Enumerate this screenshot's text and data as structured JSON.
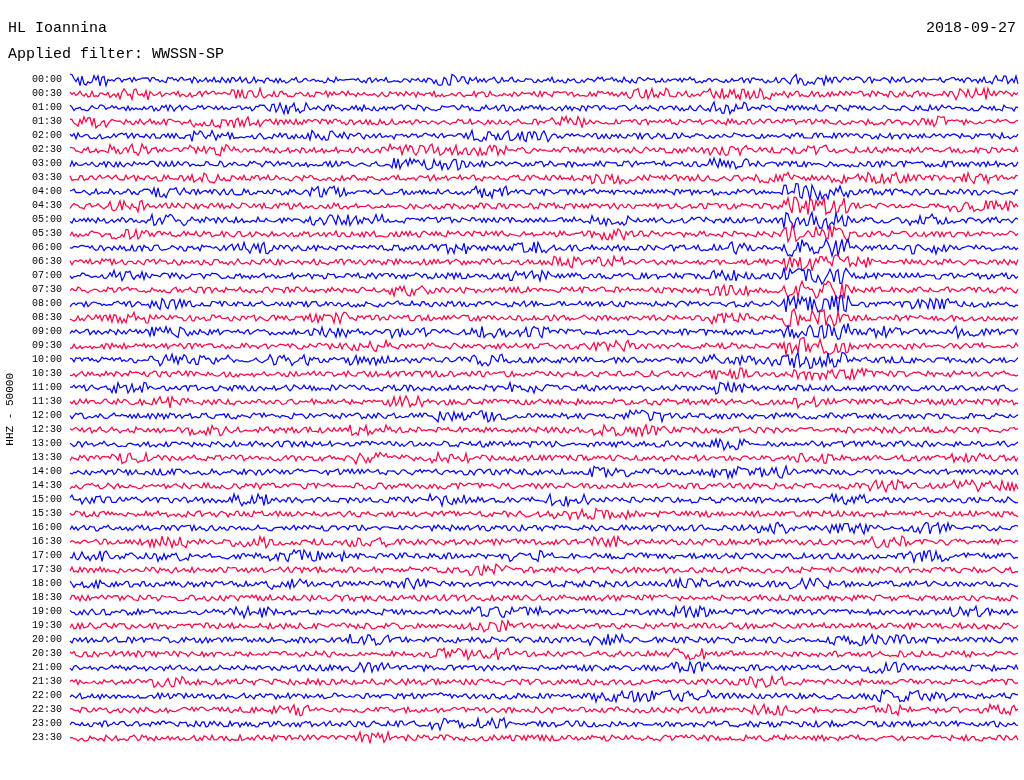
{
  "header": {
    "station": "HL Ioannina",
    "date": "2018-09-27",
    "filter": "Applied filter: WWSSN-SP"
  },
  "channel_label": "HHZ - 50000",
  "traces": [
    {
      "time": "00:00",
      "color": "#0000ff"
    },
    {
      "time": "00:30",
      "color": "#ff0040"
    },
    {
      "time": "01:00",
      "color": "#0000ff"
    },
    {
      "time": "01:30",
      "color": "#ff0040"
    },
    {
      "time": "02:00",
      "color": "#0000ff"
    },
    {
      "time": "02:30",
      "color": "#ff0040"
    },
    {
      "time": "03:00",
      "color": "#0000ff"
    },
    {
      "time": "03:30",
      "color": "#ff0040"
    },
    {
      "time": "04:00",
      "color": "#0000ff"
    },
    {
      "time": "04:30",
      "color": "#ff0040"
    },
    {
      "time": "05:00",
      "color": "#0000ff"
    },
    {
      "time": "05:30",
      "color": "#ff0040"
    },
    {
      "time": "06:00",
      "color": "#0000ff"
    },
    {
      "time": "06:30",
      "color": "#ff0040"
    },
    {
      "time": "07:00",
      "color": "#0000ff"
    },
    {
      "time": "07:30",
      "color": "#ff0040"
    },
    {
      "time": "08:00",
      "color": "#0000ff"
    },
    {
      "time": "08:30",
      "color": "#ff0040"
    },
    {
      "time": "09:00",
      "color": "#0000ff"
    },
    {
      "time": "09:30",
      "color": "#ff0040"
    },
    {
      "time": "10:00",
      "color": "#0000ff"
    },
    {
      "time": "10:30",
      "color": "#ff0040"
    },
    {
      "time": "11:00",
      "color": "#0000ff"
    },
    {
      "time": "11:30",
      "color": "#ff0040"
    },
    {
      "time": "12:00",
      "color": "#0000ff"
    },
    {
      "time": "12:30",
      "color": "#ff0040"
    },
    {
      "time": "13:00",
      "color": "#0000ff"
    },
    {
      "time": "13:30",
      "color": "#ff0040"
    },
    {
      "time": "14:00",
      "color": "#0000ff"
    },
    {
      "time": "14:30",
      "color": "#ff0040"
    },
    {
      "time": "15:00",
      "color": "#0000ff"
    },
    {
      "time": "15:30",
      "color": "#ff0040"
    },
    {
      "time": "16:00",
      "color": "#0000ff"
    },
    {
      "time": "16:30",
      "color": "#ff0040"
    },
    {
      "time": "17:00",
      "color": "#0000ff"
    },
    {
      "time": "17:30",
      "color": "#ff0040"
    },
    {
      "time": "18:00",
      "color": "#0000ff"
    },
    {
      "time": "18:30",
      "color": "#ff0040"
    },
    {
      "time": "19:00",
      "color": "#0000ff"
    },
    {
      "time": "19:30",
      "color": "#ff0040"
    },
    {
      "time": "20:00",
      "color": "#0000ff"
    },
    {
      "time": "20:30",
      "color": "#ff0040"
    },
    {
      "time": "21:00",
      "color": "#0000ff"
    },
    {
      "time": "21:30",
      "color": "#ff0040"
    },
    {
      "time": "22:00",
      "color": "#0000ff"
    },
    {
      "time": "22:30",
      "color": "#ff0040"
    },
    {
      "time": "23:00",
      "color": "#0000ff"
    },
    {
      "time": "23:30",
      "color": "#ff0040"
    }
  ]
}
